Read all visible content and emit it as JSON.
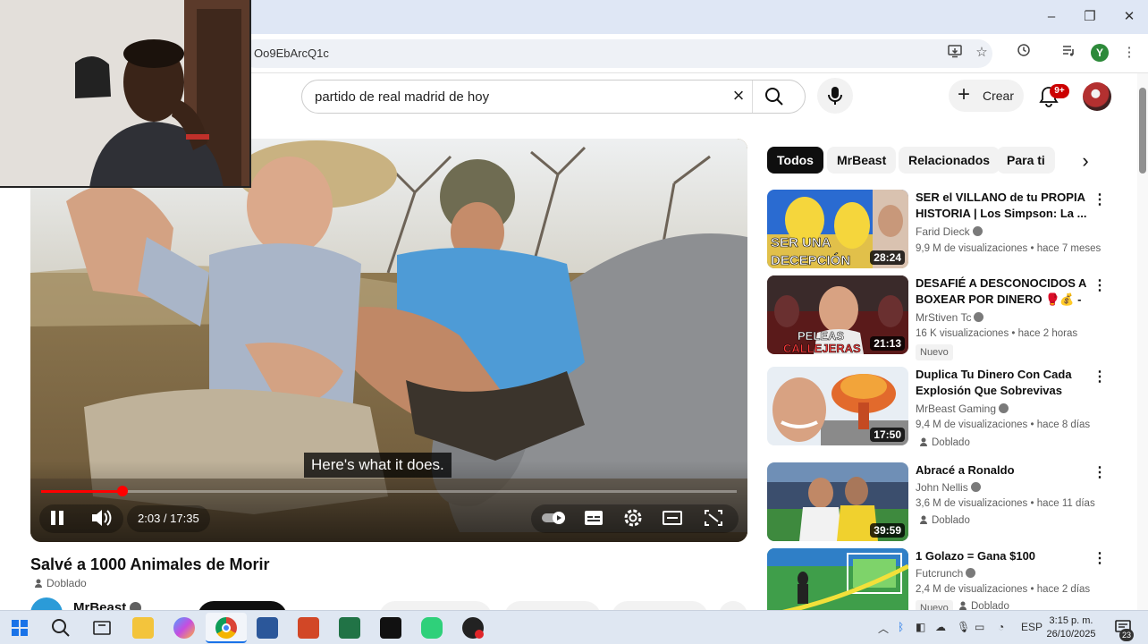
{
  "browser": {
    "url_fragment": "Oo9EbArcQ1c",
    "profile_initial": "Y"
  },
  "youtube": {
    "search_query": "partido de real madrid de hoy",
    "create_label": "Crear",
    "notification_count": "9+"
  },
  "player": {
    "caption": "Here's what it does.",
    "time": "2:03 / 17:35",
    "progress_fraction": 0.117
  },
  "video": {
    "title": "Salvé a 1000 Animales de Morir",
    "dub_label": "Doblado",
    "channel": "MrBeast"
  },
  "chips": [
    "Todos",
    "MrBeast",
    "Relacionados",
    "Para ti"
  ],
  "recommended": [
    {
      "title": "SER el VILLANO de tu PROPIA HISTORIA | Los Simpson: La ...",
      "channel": "Farid Dieck",
      "meta": "9,9 M de visualizaciones • hace 7 meses",
      "duration": "28:24",
      "thumb_text": "SER UNA DECEPCIÓN",
      "badge": "",
      "dub": ""
    },
    {
      "title": "DESAFIÉ A DESCONOCIDOS A BOXEAR POR DINERO 🥊💰 - ...",
      "channel": "MrStiven Tc",
      "meta": "16 K visualizaciones • hace 2 horas",
      "duration": "21:13",
      "thumb_text": "PELEAS CALLEJERAS",
      "badge": "Nuevo",
      "dub": ""
    },
    {
      "title": "Duplica Tu Dinero Con Cada Explosión Que Sobrevivas",
      "channel": "MrBeast Gaming",
      "meta": "9,4 M de visualizaciones • hace 8 días",
      "duration": "17:50",
      "thumb_text": "",
      "badge": "",
      "dub": "Doblado"
    },
    {
      "title": "Abracé a Ronaldo",
      "channel": "John Nellis",
      "meta": "3,6 M de visualizaciones • hace 11 días",
      "duration": "39:59",
      "thumb_text": "",
      "badge": "",
      "dub": "Doblado"
    },
    {
      "title": "1 Golazo = Gana $100",
      "channel": "Futcrunch",
      "meta": "2,4 M de visualizaciones • hace 2 días",
      "duration": "",
      "thumb_text": "",
      "badge": "Nuevo",
      "dub": "Doblado"
    }
  ],
  "taskbar": {
    "language": "ESP",
    "time": "3:15 p. m.",
    "date": "26/10/2025",
    "notification_count": "23"
  },
  "colors": {
    "accent_red": "#ff0000",
    "chip_active": "#0f0f0f",
    "badge_red": "#cc0000"
  }
}
